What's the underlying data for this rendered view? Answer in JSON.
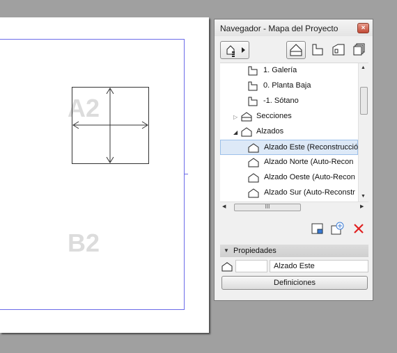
{
  "canvas": {
    "grid_labels": [
      "A2",
      "B2"
    ]
  },
  "navigator": {
    "title": "Navegador - Mapa del Proyecto",
    "close_label": "×",
    "tree": {
      "stories": [
        "1. Galería",
        "0. Planta Baja",
        "-1. Sótano"
      ],
      "sections_label": "Secciones",
      "elevations_label": "Alzados",
      "elevations": [
        "Alzado Este (Reconstrucció",
        "Alzado Norte (Auto-Recon",
        "Alzado Oeste (Auto-Recon",
        "Alzado Sur (Auto-Reconstr"
      ]
    },
    "hscroll_grip": "III",
    "properties": {
      "header": "Propiedades",
      "id_value": "",
      "name_value": "Alzado Este",
      "definitions_button": "Definiciones"
    },
    "colors": {
      "selection_bg": "#dde9f7",
      "delete_red": "#e02020",
      "sheet_border": "#6a6ae8"
    }
  }
}
